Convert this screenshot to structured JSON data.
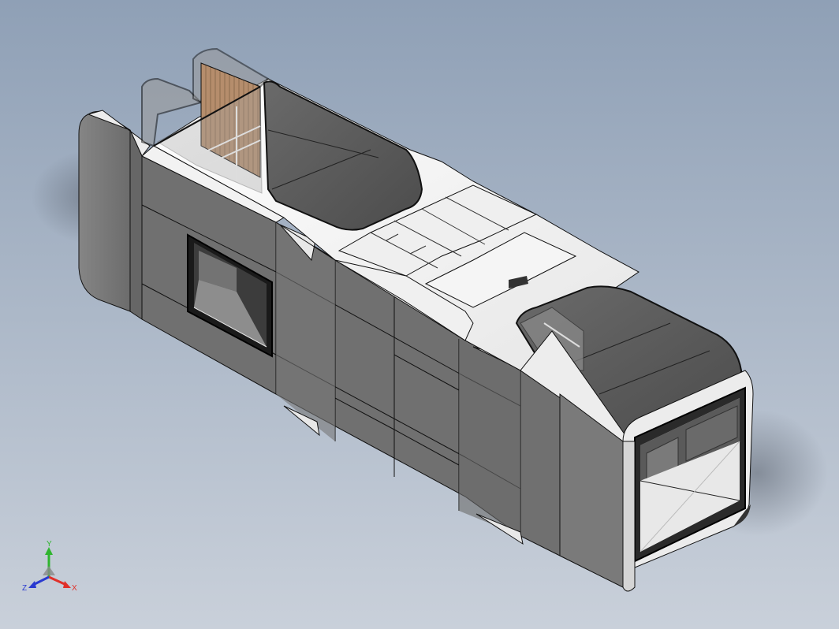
{
  "viewport": {
    "background_top": "#8fa0b6",
    "background_bottom": "#c9d0da"
  },
  "model": {
    "body_color": "#6f6f6f",
    "body_light": "#7b7b7b",
    "body_dark": "#5e5e5e",
    "trim_color": "#f2f2f2",
    "glass_color": "#575757",
    "wood_color": "#b08a6a",
    "edge_color": "#111111"
  },
  "triad": {
    "x_label": "X",
    "y_label": "Y",
    "z_label": "Z",
    "x_color": "#e0302a",
    "y_color": "#2fb52f",
    "z_color": "#2a3ad0"
  }
}
